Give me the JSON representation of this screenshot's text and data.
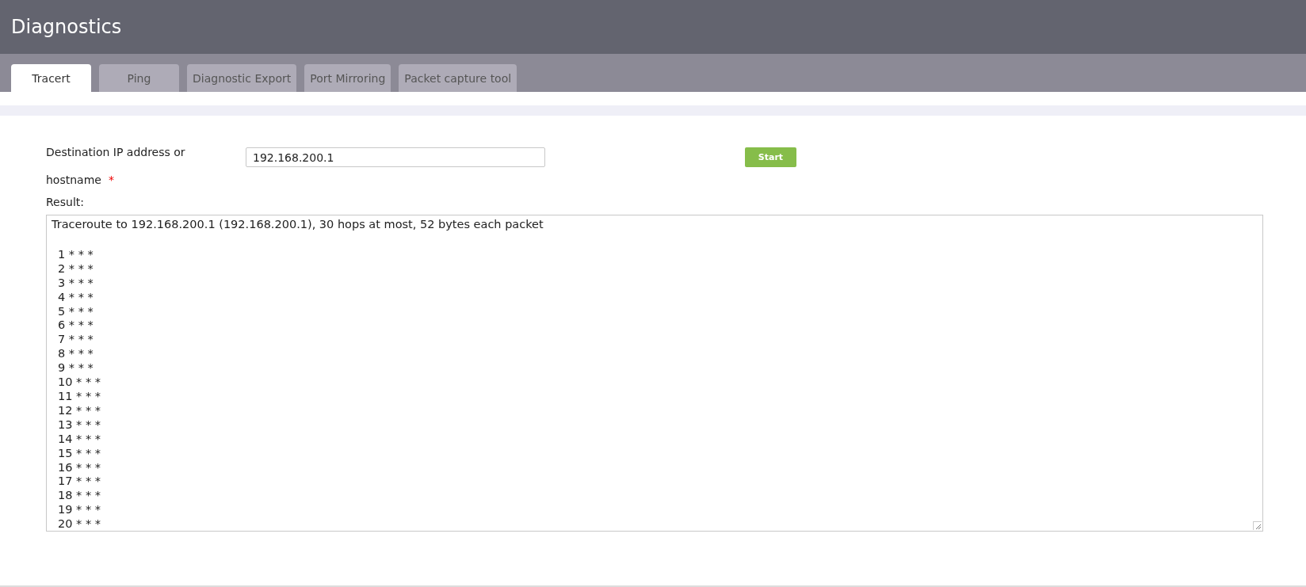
{
  "header": {
    "title": "Diagnostics"
  },
  "tabs": [
    {
      "label": "Tracert",
      "selected": true
    },
    {
      "label": "Ping",
      "selected": false
    },
    {
      "label": "Diagnostic Export",
      "selected": false
    },
    {
      "label": "Port Mirroring",
      "selected": false
    },
    {
      "label": "Packet capture tool",
      "selected": false
    }
  ],
  "form": {
    "destination_label_lines": [
      "Destination IP address or",
      "hostname"
    ],
    "required_mark": "*",
    "destination_value": "192.168.200.1",
    "start_button": "Start",
    "result_label": "Result:"
  },
  "result": {
    "heading": "Traceroute to 192.168.200.1 (192.168.200.1), 30 hops at most, 52 bytes each packet",
    "lines": [
      "1 * * *",
      "2 * * *",
      "3 * * *",
      "4 * * *",
      "5 * * *",
      "6 * * *",
      "7 * * *",
      "8 * * *",
      "9 * * *",
      "10 * * *",
      "11 * * *",
      "12 * * *",
      "13 * * *",
      "14 * * *",
      "15 * * *",
      "16 * * *",
      "17 * * *",
      "18 * * *",
      "19 * * *",
      "20 * * *"
    ]
  }
}
